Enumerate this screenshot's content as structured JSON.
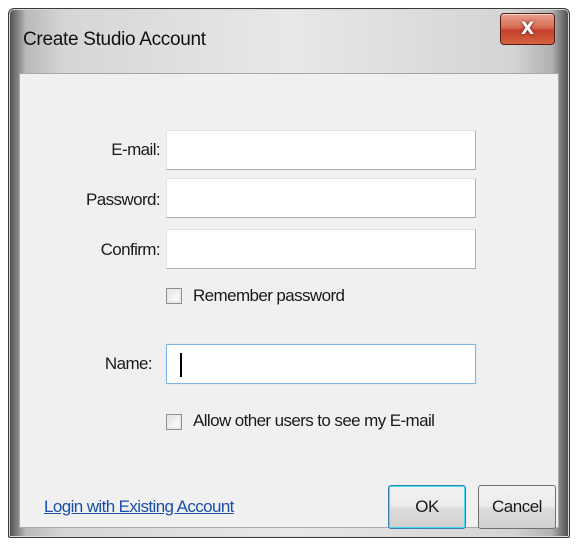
{
  "window": {
    "title": "Create Studio Account",
    "close_label": "X"
  },
  "form": {
    "email_label": "E-mail:",
    "email_value": "",
    "password_label": "Password:",
    "password_value": "",
    "confirm_label": "Confirm:",
    "confirm_value": "",
    "remember_password_label": "Remember password",
    "remember_password_checked": false,
    "name_label": "Name:",
    "name_value": "",
    "allow_email_label": "Allow other users to see my E-mail",
    "allow_email_checked": false
  },
  "footer": {
    "login_link": "Login with Existing Account",
    "ok_label": "OK",
    "cancel_label": "Cancel"
  },
  "colors": {
    "close_button": "#d4553b",
    "link": "#1a4fa8",
    "focus_border": "#7eb4ea"
  }
}
